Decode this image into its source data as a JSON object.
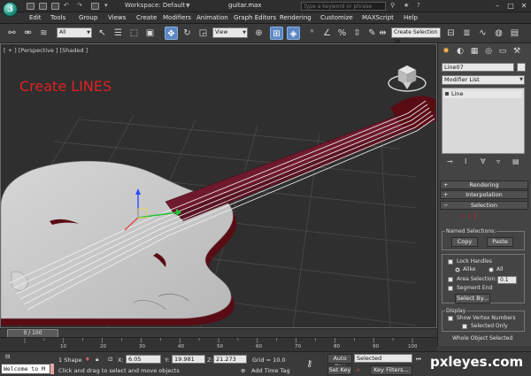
{
  "titlebar": {
    "workspace_label": "Workspace: Default",
    "file_name": "guitar.max",
    "search_placeholder": "Type a keyword or phrase"
  },
  "menu": [
    "Edit",
    "Tools",
    "Group",
    "Views",
    "Create",
    "Modifiers",
    "Animation",
    "Graph Editors",
    "Rendering",
    "Customize",
    "MAXScript",
    "Help"
  ],
  "toolbar": {
    "selection_filter": "All",
    "reference_coord": "View",
    "named_selection": "Create Selection Se"
  },
  "viewport": {
    "label": "[ + ] [Perspective ] [Shaded ]",
    "annotation": "Create LINES"
  },
  "command_panel": {
    "object_name": "Line07",
    "modifier_list": "Modifier List",
    "stack_item": "Line",
    "rollouts": {
      "rendering": "Rendering",
      "interpolation": "Interpolation",
      "selection": "Selection"
    },
    "named_selections": {
      "label": "Named Selections:",
      "copy": "Copy",
      "paste": "Paste"
    },
    "lock_handles": "Lock Handles",
    "alike": "Alike",
    "all": "All",
    "area_selection": "Area Selection:",
    "area_value": "0.1",
    "segment_end": "Segment End",
    "select_by": "Select By...",
    "display": {
      "label": "Display",
      "show_vertex_numbers": "Show Vertex Numbers",
      "selected_only": "Selected Only"
    },
    "whole_object_selected": "Whole Object Selected"
  },
  "timeline": {
    "frame": "0 / 100",
    "ticks": [
      "10",
      "20",
      "30",
      "40",
      "50",
      "60",
      "70",
      "80",
      "90",
      "100"
    ]
  },
  "status": {
    "listener_text": "Welcome to M",
    "selection_count": "1 Shape",
    "x_label": "X:",
    "x_value": "6.05",
    "y_label": "Y:",
    "y_value": "19.981",
    "z_label": "Z:",
    "z_value": "21.273",
    "grid": "Grid = 10.0",
    "auto_key": "Auto Key",
    "set_key": "Set Key",
    "key_mode": "Selected",
    "key_filters": "Key Filters...",
    "prompt": "Click and drag to select and move objects",
    "add_time_tag": "Add Time Tag"
  },
  "watermark": "pxleyes.com",
  "colors": {
    "annotation": "#e02020",
    "guitar_body": "#c9c9c9",
    "guitar_edge": "#5a0c14",
    "neck": "#5a1424",
    "strings": "#f2f2f2",
    "active_tool": "#5b87c4"
  }
}
